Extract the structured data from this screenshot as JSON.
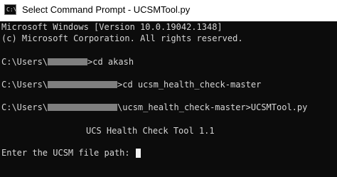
{
  "window": {
    "title": "Select Command Prompt - UCSMTool.py",
    "icon": "command-prompt-icon",
    "icon_glyph": "C:\\"
  },
  "console": {
    "version_line": "Microsoft Windows [Version 10.0.19042.1348]",
    "copyright_line": "(c) Microsoft Corporation. All rights reserved.",
    "commands": [
      {
        "prefix": "C:\\Users\\",
        "suffix": ">cd akash"
      },
      {
        "prefix": "C:\\Users\\",
        "suffix": ">cd ucsm_health_check-master"
      },
      {
        "prefix": "C:\\Users\\",
        "suffix": "\\ucsm_health_check-master>UCSMTool.py"
      }
    ],
    "banner": "UCS Health Check Tool 1.1",
    "prompt": "Enter the UCSM file path: "
  },
  "colors": {
    "console_background": "#0c0c0c",
    "console_text": "#d6d6d6",
    "redaction": "#7f7f7f",
    "cursor": "#f2f2f2"
  }
}
